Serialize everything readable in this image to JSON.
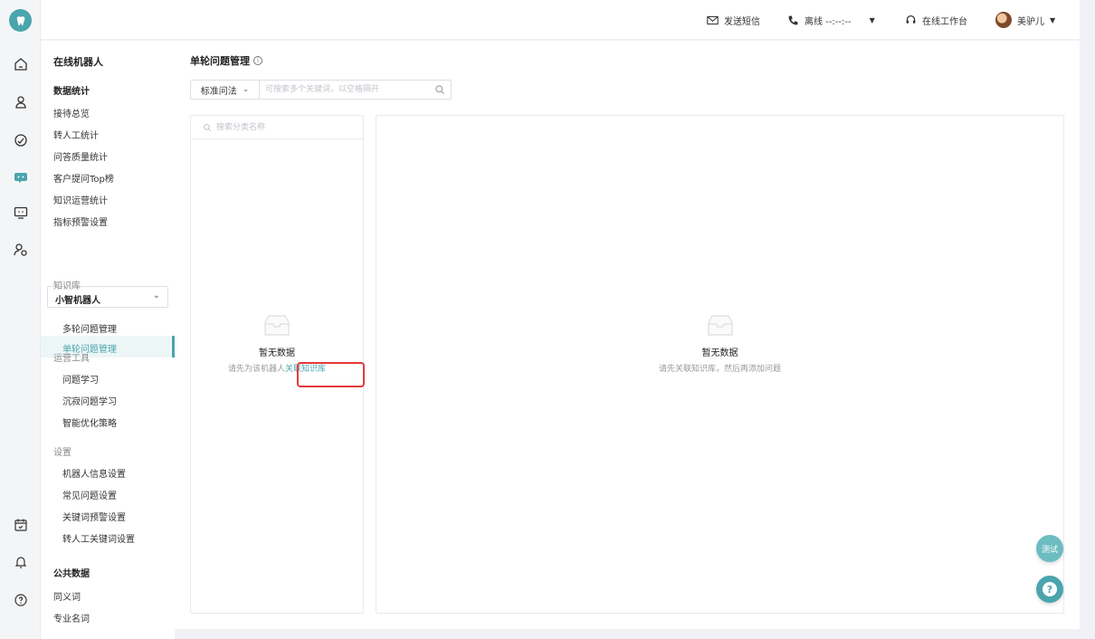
{
  "topbar": {
    "sms_label": "发送短信",
    "status_label": "离线 --:--:--",
    "workbench_label": "在线工作台",
    "user_name": "美驴儿"
  },
  "sidebar": {
    "title": "在线机器人",
    "stats_section": "数据统计",
    "stats_items": [
      "接待总览",
      "转人工统计",
      "问答质量统计",
      "客户提问Top榜",
      "知识运营统计",
      "指标预警设置"
    ],
    "robot_select": "小智机器人",
    "kb_head": "知识库",
    "kb_items": [
      "单轮问题管理",
      "多轮问题管理"
    ],
    "ops_head": "运营工具",
    "ops_items": [
      "问题学习",
      "沉寂问题学习",
      "智能优化策略"
    ],
    "settings_head": "设置",
    "settings_items": [
      "机器人信息设置",
      "常见问题设置",
      "关键词预警设置",
      "转人工关键词设置"
    ],
    "public_section": "公共数据",
    "public_items": [
      "同义词",
      "专业名词"
    ]
  },
  "main": {
    "page_title": "单轮问题管理",
    "query_type": "标准问法",
    "query_placeholder": "可搜索多个关键词，以空格隔开",
    "category_placeholder": "搜索分类名称",
    "left_empty": {
      "title": "暂无数据",
      "desc_prefix": "请先为该机器人",
      "desc_link": "关联知识库"
    },
    "right_empty": {
      "title": "暂无数据",
      "desc": "请先关联知识库，然后再添加问题"
    }
  },
  "fab": {
    "test_label": "测试",
    "help_label": "?"
  },
  "colors": {
    "accent": "#4aa5ad",
    "highlight": "#e5393a"
  }
}
